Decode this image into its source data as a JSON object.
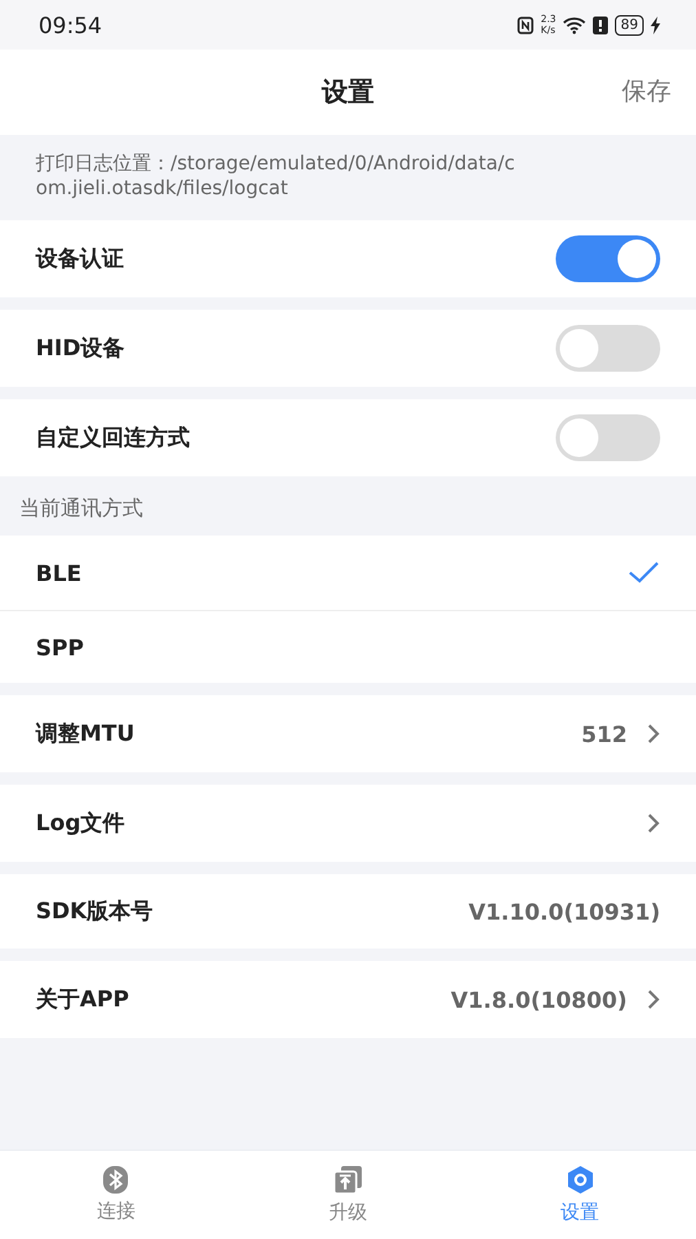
{
  "status_bar": {
    "time": "09:54",
    "speed": "2.3",
    "speed_unit": "K/s",
    "battery": "89"
  },
  "header": {
    "title": "设置",
    "action": "保存"
  },
  "log_path": "打印日志位置：/storage/emulated/0/Android/data/com.jieli.otasdk/files/logcat",
  "groups": [
    {
      "rows": [
        {
          "kind": "toggle",
          "label": "设备认证",
          "on": true
        }
      ]
    },
    {
      "rows": [
        {
          "kind": "toggle",
          "label": "HID设备",
          "on": false
        }
      ]
    },
    {
      "rows": [
        {
          "kind": "toggle",
          "label": "自定义回连方式",
          "on": false
        }
      ]
    },
    {
      "label": "当前通讯方式",
      "rows": [
        {
          "kind": "choice",
          "label": "BLE",
          "selected": true
        },
        {
          "kind": "choice",
          "label": "SPP",
          "selected": false
        }
      ]
    },
    {
      "rows": [
        {
          "kind": "link",
          "label": "调整MTU",
          "value": "512"
        }
      ]
    },
    {
      "rows": [
        {
          "kind": "link",
          "label": "Log文件"
        }
      ]
    },
    {
      "rows": [
        {
          "kind": "info",
          "label": "SDK版本号",
          "value": "V1.10.0(10931)"
        }
      ]
    },
    {
      "rows": [
        {
          "kind": "link",
          "label": "关于APP",
          "value": "V1.8.0(10800)"
        }
      ]
    }
  ],
  "tabs": [
    {
      "kind": "bluetooth",
      "label": "连接",
      "selected": false
    },
    {
      "kind": "upgrade",
      "label": "升级",
      "selected": false
    },
    {
      "kind": "settings",
      "label": "设置",
      "selected": true
    }
  ]
}
